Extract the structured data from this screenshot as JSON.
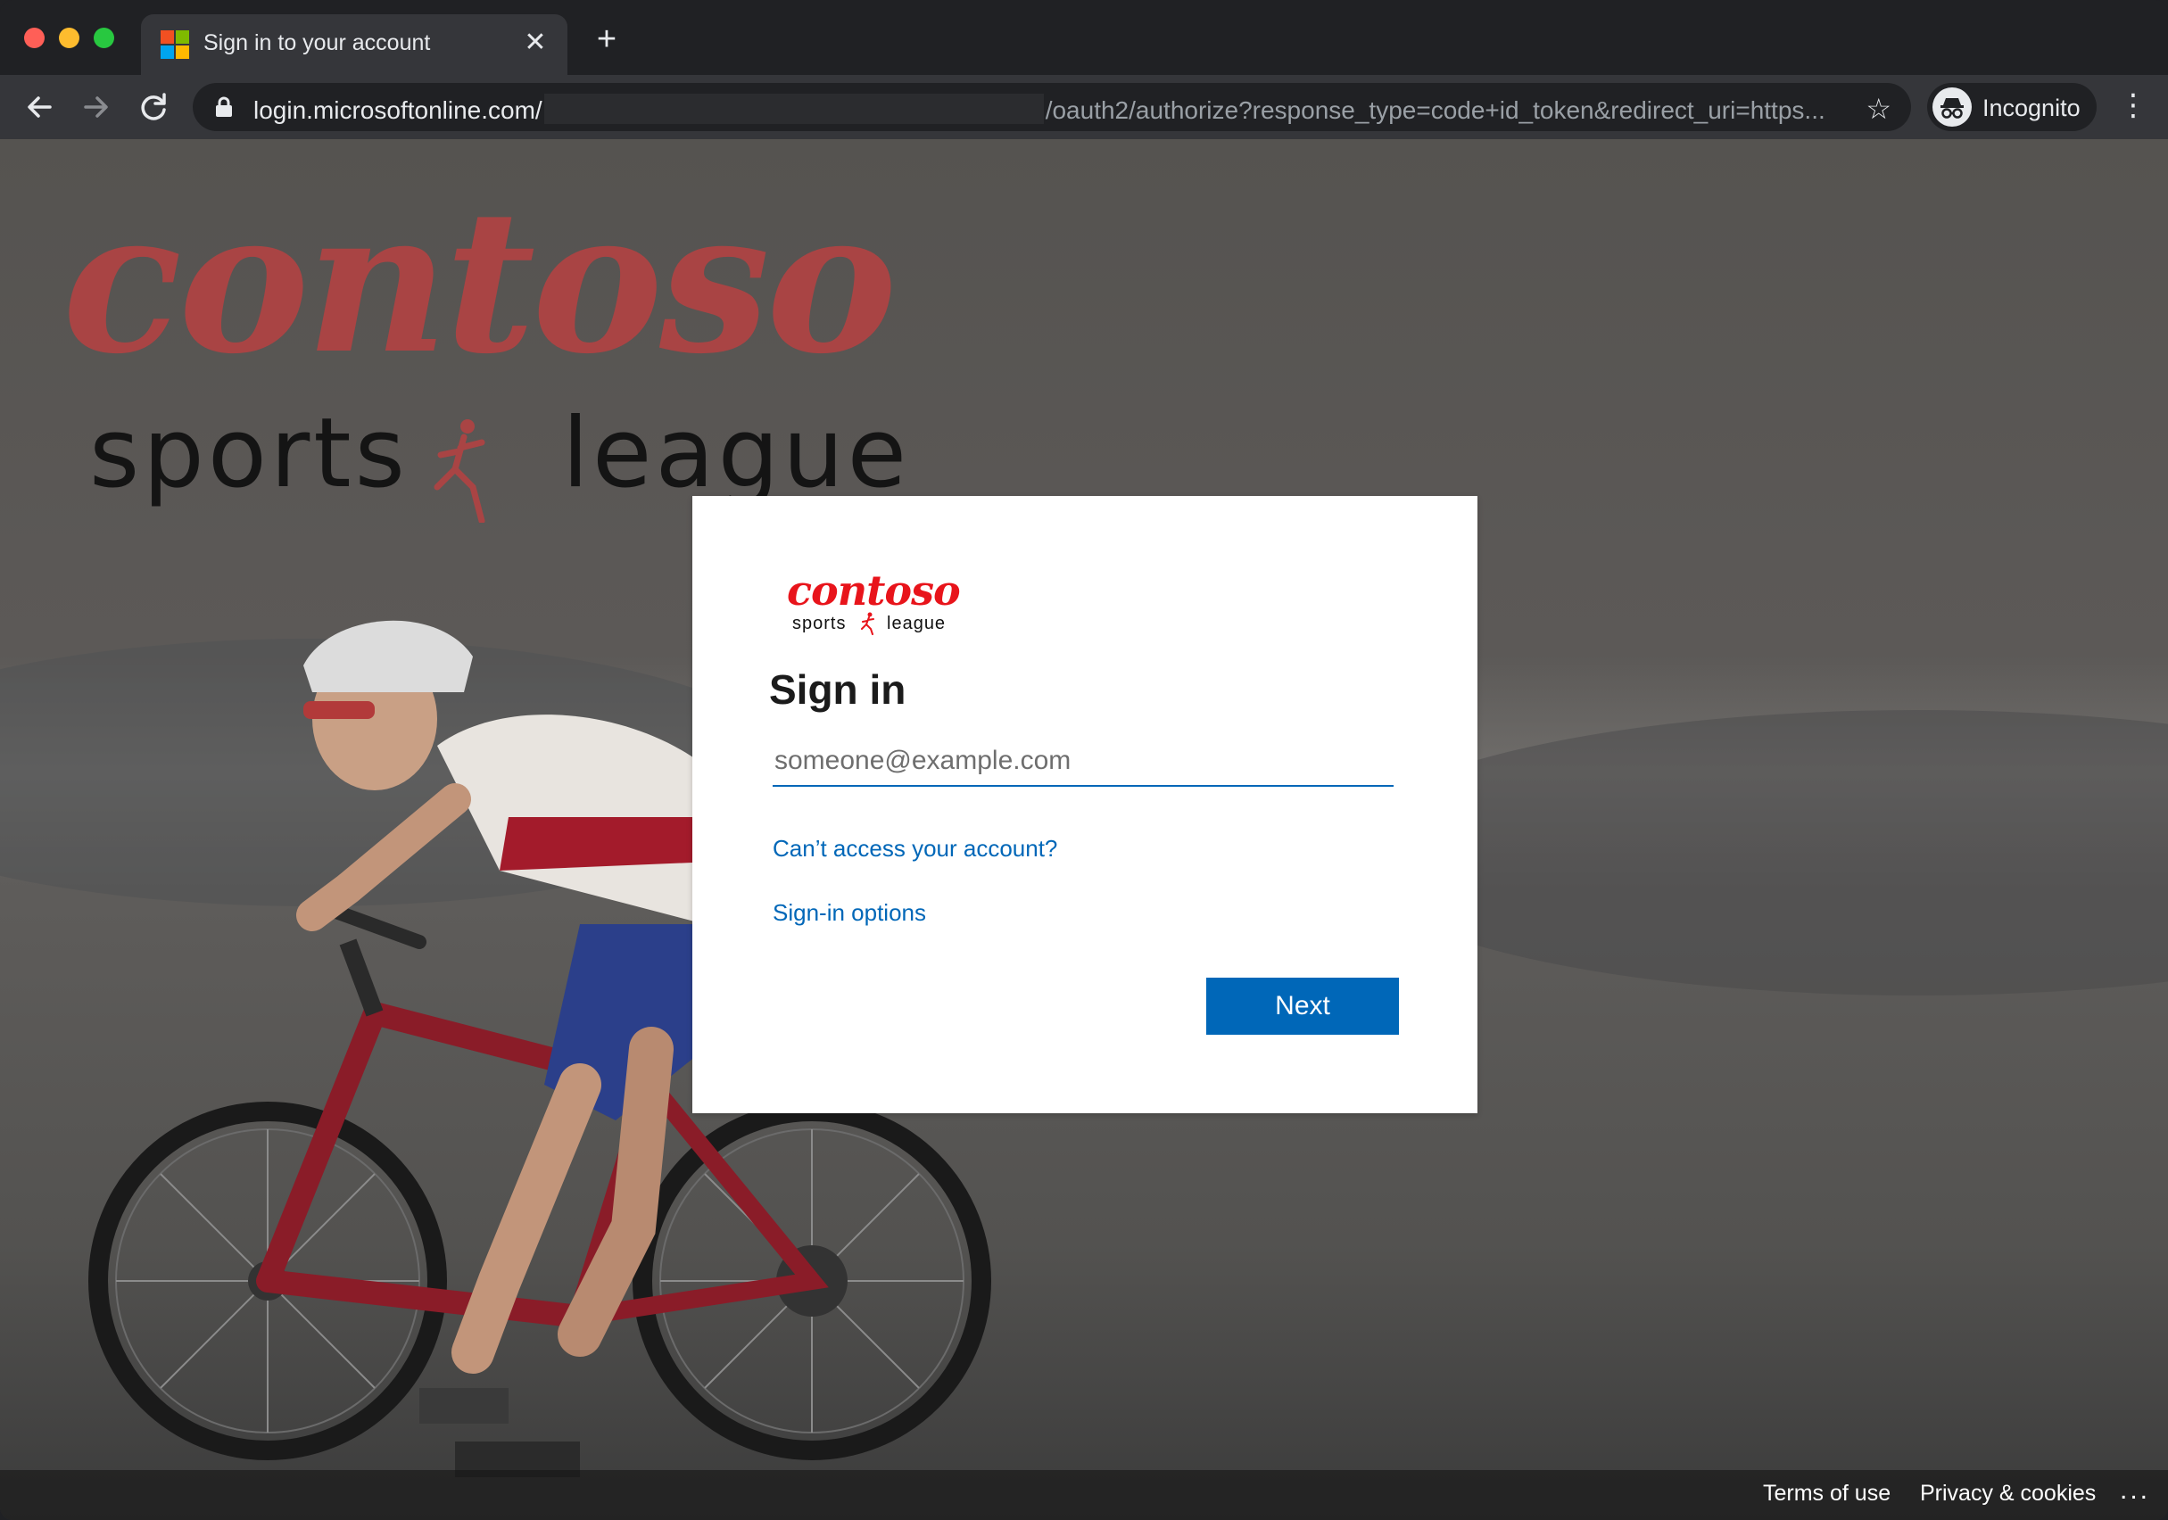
{
  "browser": {
    "tab_title": "Sign in to your account",
    "url_host": "login.microsoftonline.com/",
    "url_path": "/oauth2/authorize?response_type=code+id_token&redirect_uri=https...",
    "profile_label": "Incognito",
    "icons": {
      "back": "arrow-left-icon",
      "forward": "arrow-right-icon",
      "reload": "reload-icon",
      "lock": "lock-icon",
      "star": "star-icon",
      "incognito": "incognito-icon",
      "menu": "kebab-menu-icon",
      "new_tab": "plus-icon",
      "close_tab": "close-icon"
    }
  },
  "background": {
    "brand_word": "contoso",
    "tagline_left": "sports",
    "tagline_right": "league"
  },
  "signin": {
    "logo_word": "contoso",
    "logo_left": "sports",
    "logo_right": "league",
    "heading": "Sign in",
    "email_placeholder": "someone@example.com",
    "email_value": "",
    "cant_access_link": "Can’t access your account?",
    "options_link": "Sign-in options",
    "next_label": "Next"
  },
  "footer": {
    "terms": "Terms of use",
    "privacy": "Privacy & cookies",
    "more": "..."
  },
  "colors": {
    "accent": "#0067b8",
    "brand_red": "#e8141b",
    "card": "#ffffff",
    "chrome_dark": "#202124",
    "chrome_toolbar": "#35363a"
  }
}
